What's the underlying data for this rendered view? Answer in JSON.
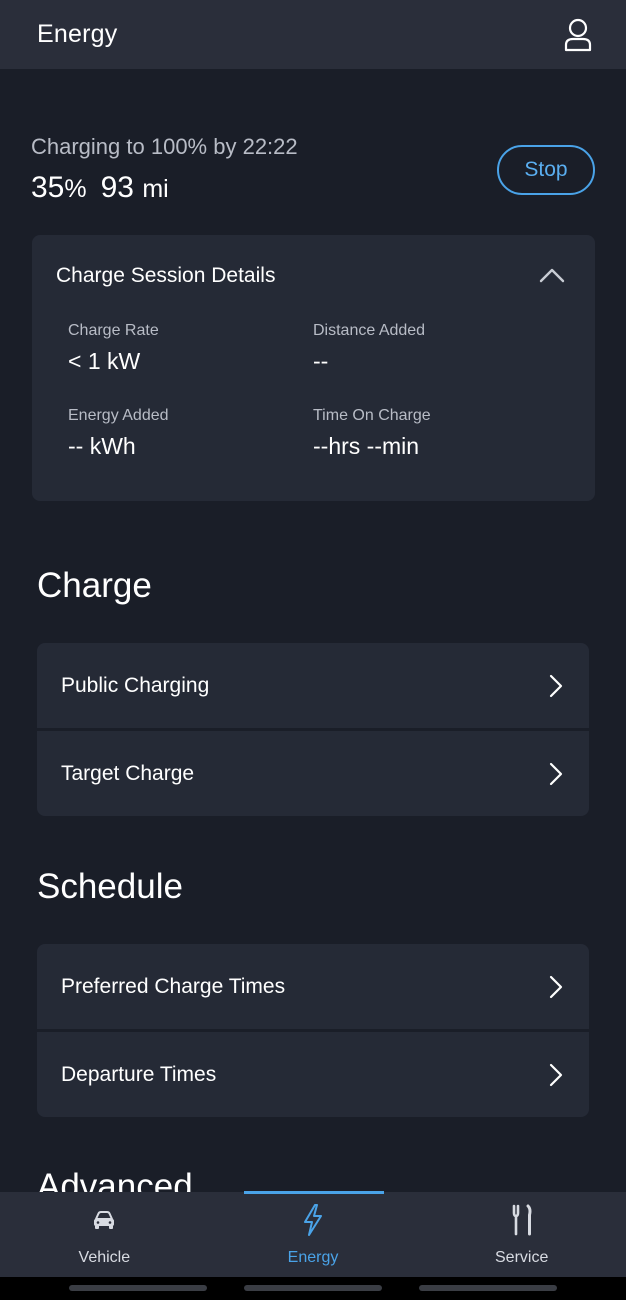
{
  "header": {
    "title": "Energy"
  },
  "status": {
    "charging_text": "Charging to 100% by 22:22",
    "percent": "35",
    "percent_unit": "%",
    "range": "93",
    "range_unit": "mi",
    "stop_label": "Stop"
  },
  "session": {
    "title": "Charge Session Details",
    "stats": {
      "charge_rate": {
        "label": "Charge Rate",
        "value": "< 1 kW"
      },
      "distance_added": {
        "label": "Distance Added",
        "value": "--"
      },
      "energy_added": {
        "label": "Energy Added",
        "value": "-- kWh"
      },
      "time_on_charge": {
        "label": "Time On Charge",
        "value": "--hrs --min"
      }
    }
  },
  "charge_section": {
    "heading": "Charge",
    "items": [
      {
        "label": "Public Charging"
      },
      {
        "label": "Target Charge"
      }
    ]
  },
  "schedule_section": {
    "heading": "Schedule",
    "items": [
      {
        "label": "Preferred Charge Times"
      },
      {
        "label": "Departure Times"
      }
    ]
  },
  "advanced_section": {
    "heading": "Advanced"
  },
  "nav": {
    "items": [
      {
        "label": "Vehicle",
        "icon": "car-icon"
      },
      {
        "label": "Energy",
        "icon": "lightning-icon",
        "active": true
      },
      {
        "label": "Service",
        "icon": "tools-icon"
      }
    ]
  },
  "colors": {
    "background": "#1a1e28",
    "card": "#252a36",
    "header": "#2a2e3a",
    "accent": "#4aa3e8"
  }
}
